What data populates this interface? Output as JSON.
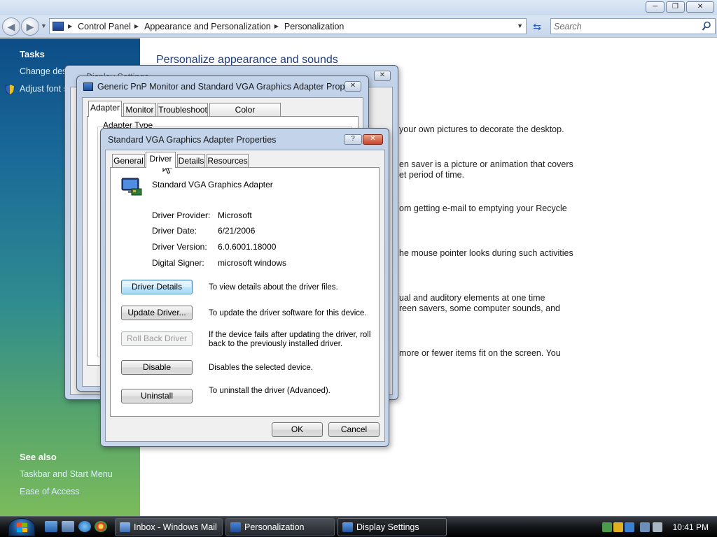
{
  "explorer": {
    "breadcrumbs": [
      "Control Panel",
      "Appearance and Personalization",
      "Personalization"
    ],
    "search_placeholder": "Search",
    "caption_buttons": {
      "minimize": "─",
      "maximize": "❐",
      "close": "✕"
    }
  },
  "left_pane": {
    "tasks_heading": "Tasks",
    "tasks": [
      "Change desk",
      "Adjust font s"
    ],
    "see_also_heading": "See also",
    "see_also": [
      "Taskbar and Start Menu",
      "Ease of Access"
    ]
  },
  "content": {
    "title": "Personalize appearance and sounds",
    "fragments": [
      "your own pictures to decorate the desktop.",
      "en saver is a picture or animation that covers",
      "et period of time.",
      "om getting e-mail to emptying your Recycle",
      "he mouse pointer looks during such activities",
      "ual and auditory elements at one time",
      "reen savers, some computer sounds, and",
      "more or fewer items fit on the screen. You"
    ]
  },
  "display_settings_dialog": {
    "title": "Display Settings"
  },
  "monitor_dialog": {
    "title": "Generic PnP Monitor and Standard VGA Graphics Adapter Prope...",
    "tabs": [
      "Adapter",
      "Monitor",
      "Troubleshoot",
      "Color Management"
    ],
    "active_tab": "Adapter",
    "adapter_type_label": "Adapter Type"
  },
  "adapter_dialog": {
    "title": "Standard VGA Graphics Adapter Properties",
    "help": "?",
    "tabs": [
      "General",
      "Driver",
      "Details",
      "Resources"
    ],
    "active_tab": "Driver",
    "device_name": "Standard VGA Graphics Adapter",
    "fields": [
      {
        "label": "Driver Provider:",
        "value": "Microsoft"
      },
      {
        "label": "Driver Date:",
        "value": "6/21/2006"
      },
      {
        "label": "Driver Version:",
        "value": "6.0.6001.18000"
      },
      {
        "label": "Digital Signer:",
        "value": "microsoft windows"
      }
    ],
    "actions": [
      {
        "label": "Driver Details",
        "desc": "To view details about the driver files.",
        "state": "focused"
      },
      {
        "label": "Update Driver...",
        "desc": "To update the driver software for this device.",
        "state": "normal"
      },
      {
        "label": "Roll Back Driver",
        "desc": "If the device fails after updating the driver, roll back to the previously installed driver.",
        "state": "disabled"
      },
      {
        "label": "Disable",
        "desc": "Disables the selected device.",
        "state": "normal"
      },
      {
        "label": "Uninstall",
        "desc": "To uninstall the driver (Advanced).",
        "state": "normal"
      }
    ],
    "ok": "OK",
    "cancel": "Cancel"
  },
  "taskbar": {
    "tasks": [
      "Inbox - Windows Mail",
      "Personalization",
      "Display Settings"
    ],
    "active_task": "Display Settings",
    "clock": "10:41 PM"
  },
  "colors": {
    "link": "#1e3d86",
    "leftpane_top": "#0d4d87",
    "leftpane_bottom": "#7cbb5c",
    "focus_button": "#a7d9f5"
  }
}
